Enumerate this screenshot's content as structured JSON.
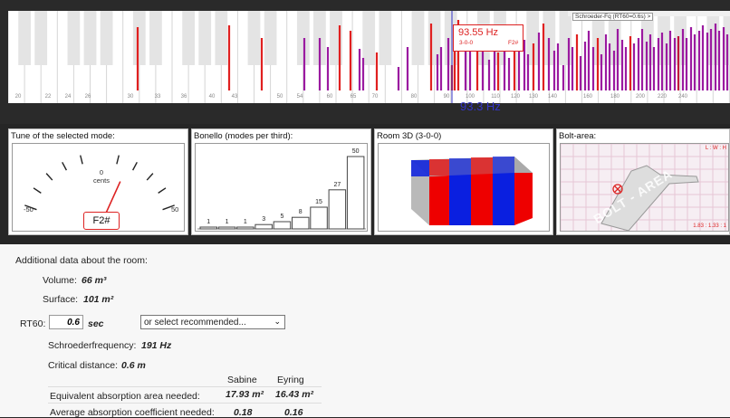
{
  "spectrum": {
    "schroeder_label": "Schroeder-Fq (RT60=0.6s) >",
    "tooltip": {
      "freq": "93.55 Hz",
      "mode": "3-0-0",
      "note": "F2#"
    },
    "cursor_label": "93.3 Hz",
    "ticks": [
      "20",
      "22",
      "24",
      "26",
      "30",
      "33",
      "36",
      "40",
      "43",
      "50",
      "54",
      "60",
      "65",
      "70",
      "80",
      "90",
      "100",
      "110",
      "120",
      "130",
      "140",
      "160",
      "180",
      "200",
      "220",
      "240"
    ]
  },
  "panels": {
    "tune": {
      "title": "Tune of the selected mode:",
      "value": "0",
      "unit": "cents",
      "min": "-50",
      "max": "50",
      "note": "F2#",
      "needle_cents": 14
    },
    "bonello": {
      "title": "Bonello (modes per third):",
      "values": [
        1,
        1,
        1,
        3,
        5,
        8,
        15,
        27,
        50
      ]
    },
    "room3d": {
      "title": "Room 3D (3-0-0)"
    },
    "bolt": {
      "title": "Bolt-area:",
      "legend": "L : W : H",
      "ratio": "1.83 : 1.33 : 1",
      "watermark": "BOLT - AREA"
    }
  },
  "room": {
    "heading": "Additional data about the room:",
    "volume_label": "Volume:",
    "volume_value": "66 m³",
    "surface_label": "Surface:",
    "surface_value": "101 m²",
    "rt60_label": "RT60:",
    "rt60_value": "0.6",
    "rt60_unit": "sec",
    "rt60_select": "or select recommended...",
    "schroeder_label": "Schroederfrequency:",
    "schroeder_value": "191 Hz",
    "critical_label": "Critical distance:",
    "critical_value": "0.6 m",
    "col_sabine": "Sabine",
    "col_eyring": "Eyring",
    "row1_label": "Equivalent absorption area needed:",
    "row1_sabine": "17.93 m²",
    "row1_eyring": "16.43 m²",
    "row2_label": "Average absorption coefficient needed:",
    "row2_sabine": "0.18",
    "row2_eyring": "0.16"
  }
}
